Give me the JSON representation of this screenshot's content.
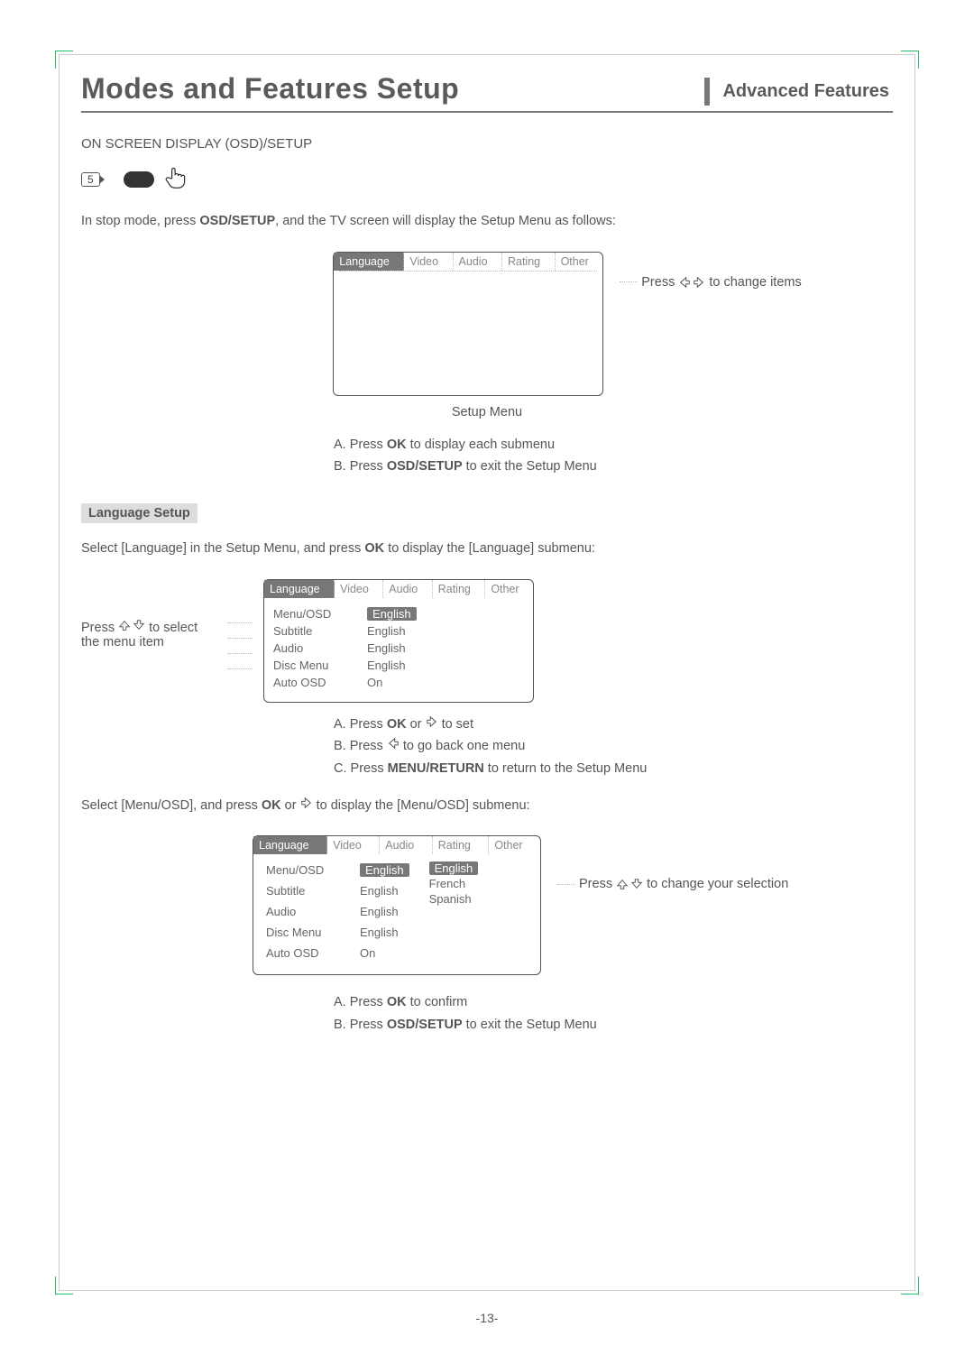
{
  "header": {
    "title": "Modes and Features Setup",
    "tab": "Advanced Features"
  },
  "section1": {
    "heading": "ON SCREEN DISPLAY (OSD)/SETUP",
    "remote_key": "5",
    "intro_a": "In stop mode, press ",
    "intro_b": "OSD/SETUP",
    "intro_c": ", and the TV screen will display the Setup Menu as follows:"
  },
  "osd_tabs": [
    "Language",
    "Video",
    "Audio",
    "Rating",
    "Other"
  ],
  "callout_lr": " to change items",
  "callout_lr_prefix": "Press ",
  "setup_caption": "Setup Menu",
  "steps1": {
    "a1": "A. Press ",
    "a2": "OK",
    "a3": " to display each submenu",
    "b1": "B. Press ",
    "b2": "OSD/SETUP",
    "b3": " to exit the Setup Menu"
  },
  "lang_setup_heading": "Language Setup",
  "lang_intro_a": "Select [Language] in the Setup Menu, and press ",
  "lang_intro_b": "OK",
  "lang_intro_c": " to display the [Language] submenu:",
  "left_callout_a": "Press ",
  "left_callout_b": " to select the menu item",
  "lang_rows": [
    {
      "label": "Menu/OSD",
      "value": "English",
      "selected": true
    },
    {
      "label": "Subtitle",
      "value": "English",
      "selected": false
    },
    {
      "label": "Audio",
      "value": "English",
      "selected": false
    },
    {
      "label": "Disc Menu",
      "value": "English",
      "selected": false
    },
    {
      "label": "Auto OSD",
      "value": "On",
      "selected": false
    }
  ],
  "steps2": {
    "a1": "A.  Press ",
    "a2": "OK",
    "a3": " or ",
    "a4": " to set",
    "b1": "B.  Press ",
    "b2": " to go back one menu",
    "c1": "C.  Press ",
    "c2": "MENU/RETURN",
    "c3": " to return to the Setup Menu"
  },
  "menuosd_intro_a": "Select [Menu/OSD], and press ",
  "menuosd_intro_b": "OK",
  "menuosd_intro_c": " or ",
  "menuosd_intro_d": " to display the [Menu/OSD] submenu:",
  "lang_rows2": [
    {
      "label": "Menu/OSD",
      "value": "English",
      "selected": true
    },
    {
      "label": "Subtitle",
      "value": "English"
    },
    {
      "label": "Audio",
      "value": "English"
    },
    {
      "label": "Disc Menu",
      "value": "English"
    },
    {
      "label": "Auto OSD",
      "value": "On"
    }
  ],
  "opts": [
    "English",
    "French",
    "Spanish"
  ],
  "opts_selected": "English",
  "callout_ud_prefix": "Press ",
  "callout_ud": " to change your selection",
  "steps3": {
    "a1": "A.  Press ",
    "a2": "OK",
    "a3": " to confirm",
    "b1": "B.  Press ",
    "b2": "OSD/SETUP",
    "b3": " to exit the Setup Menu"
  },
  "page_number": "-13-"
}
